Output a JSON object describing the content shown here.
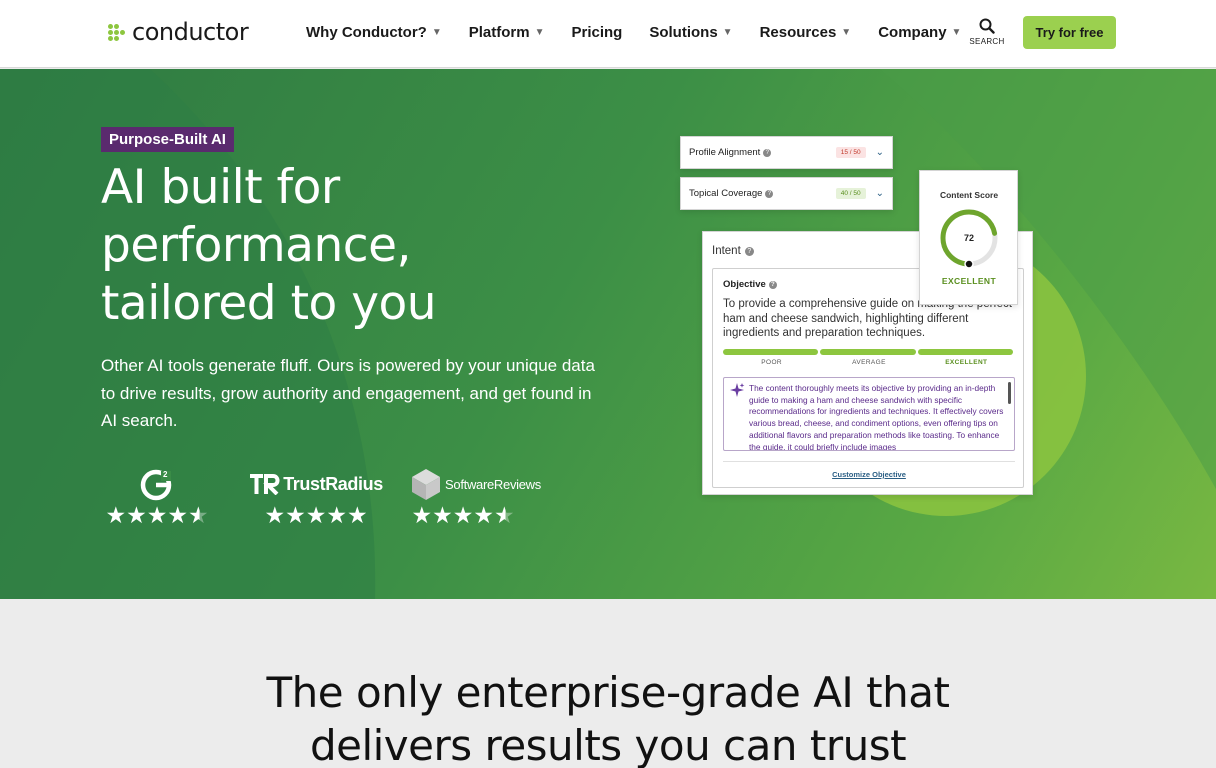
{
  "header": {
    "logo_text": "conductor",
    "nav": [
      {
        "label": "Why Conductor?",
        "has_dropdown": true
      },
      {
        "label": "Platform",
        "has_dropdown": true
      },
      {
        "label": "Pricing",
        "has_dropdown": false
      },
      {
        "label": "Solutions",
        "has_dropdown": true
      },
      {
        "label": "Resources",
        "has_dropdown": true
      },
      {
        "label": "Company",
        "has_dropdown": true
      }
    ],
    "search_label": "SEARCH",
    "cta_label": "Try for free"
  },
  "hero": {
    "badge": "Purpose-Built AI",
    "headline_lines": [
      "AI built for",
      "performance,",
      "tailored to you"
    ],
    "subtext": "Other AI tools generate fluff. Ours is powered by your unique data to drive results, grow authority and engagement, and get found in AI search.",
    "ratings": [
      {
        "brand": "G2",
        "stars": 4.5
      },
      {
        "brand": "TrustRadius",
        "stars": 5
      },
      {
        "brand": "SoftwareReviews",
        "stars": 4.5
      }
    ],
    "product": {
      "metrics": [
        {
          "label": "Profile Alignment",
          "score": "15 / 50",
          "status_color": "#c0392b"
        },
        {
          "label": "Topical Coverage",
          "score": "40 / 50",
          "status_color": "#5a8f1f"
        }
      ],
      "intent": {
        "title": "Intent",
        "objective_label": "Objective",
        "objective_text": "To provide a comprehensive guide on making the perfect ham and cheese sandwich, highlighting different ingredients and preparation techniques.",
        "scale": [
          "POOR",
          "AVERAGE",
          "EXCELLENT"
        ],
        "feedback": "The content thoroughly meets its objective by providing an in-depth guide to making a ham and cheese sandwich with specific recommendations for ingredients and techniques. It effectively covers various bread, cheese, and condiment options, even offering tips on additional flavors and preparation methods like toasting. To enhance the guide, it could briefly include images",
        "customize_label": "Customize Objective"
      },
      "content_score": {
        "title": "Content Score",
        "value": 72,
        "max": 100,
        "rating": "EXCELLENT"
      }
    }
  },
  "lower": {
    "title_lines": [
      "The only enterprise-grade AI that",
      "delivers results you can trust"
    ]
  },
  "colors": {
    "accent": "#9bd04f",
    "badge": "#5a2a6e",
    "hero_green": "#3c8f46"
  }
}
